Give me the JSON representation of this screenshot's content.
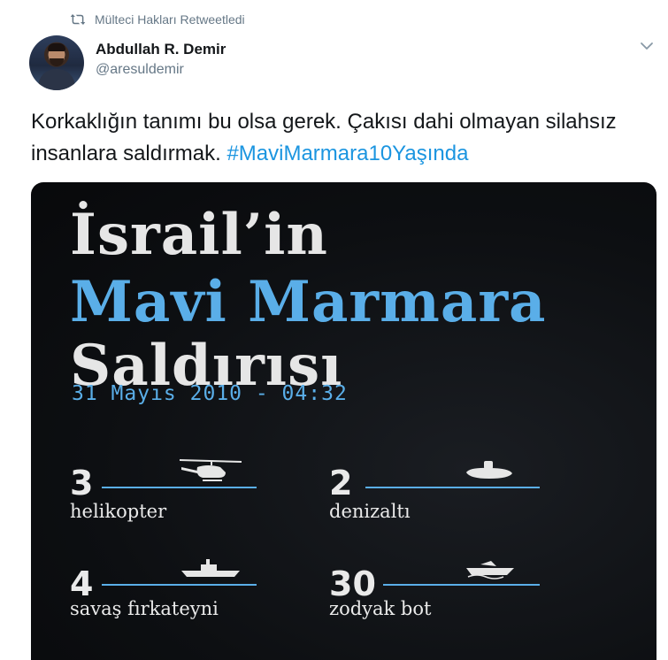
{
  "retweet": {
    "icon": "retweet-icon",
    "text": "Mülteci Hakları Retweetledi"
  },
  "author": {
    "display_name": "Abdullah R. Demir",
    "handle": "@aresuldemir"
  },
  "tweet": {
    "text_before": "Korkaklığın tanımı bu olsa gerek. Çakısı dahi olmayan silahsız insanlara saldırmak.",
    "hashtag": "#MaviMarmara10Yaşında"
  },
  "media": {
    "title_line1": "İsrail’in",
    "title_line2": "Mavi Marmara",
    "title_line3": "Saldırısı",
    "date": "31 Mayıs 2010 - 04:32",
    "stats": [
      {
        "number": "3",
        "label": "helikopter",
        "icon": "helicopter-icon"
      },
      {
        "number": "2",
        "label": "denizaltı",
        "icon": "submarine-icon"
      },
      {
        "number": "4",
        "label": "savaş fırkateyni",
        "icon": "frigate-icon"
      },
      {
        "number": "30",
        "label": "zodyak bot",
        "icon": "zodiac-boat-icon"
      }
    ]
  },
  "colors": {
    "accent": "#1b95e0",
    "muted": "#657786",
    "poster_blue": "#5aaee8",
    "poster_bg": "#0d0f12"
  }
}
